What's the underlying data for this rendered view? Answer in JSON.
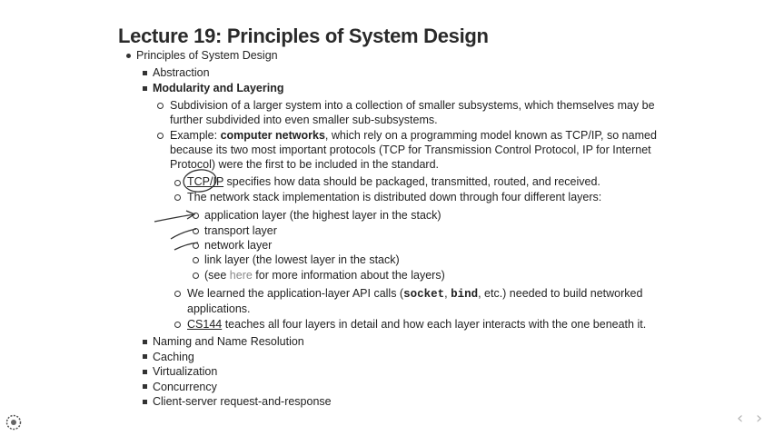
{
  "title": "Lecture 19: Principles of System Design",
  "items": {
    "principles": "Principles of System Design",
    "abstraction": "Abstraction",
    "modularity": "Modularity and Layering",
    "subdivision_1": "Subdivision of a larger system into a collection of smaller subsystems, which themselves may be",
    "subdivision_2": "further subdivided into even smaller sub-subsystems.",
    "example_prefix": "Example: ",
    "example_bold": "computer networks",
    "example_rest": ", which rely on a programming model known as TCP/IP, so named",
    "example_2": "because its two most important protocols (TCP for Transmission Control Protocol, IP for Internet",
    "example_3": "Protocol) were the first to be included in the standard.",
    "tcpip_link": "TCP/IP",
    "tcpip_rest": " specifies how data should be packaged, transmitted, routed, and received.",
    "stack": "The network stack implementation is distributed down through four different layers:",
    "layer_app": "application layer (the highest layer in the stack)",
    "layer_transport": "transport layer",
    "layer_network": "network layer",
    "layer_link": "link layer (the lowest layer in the stack)",
    "see_prefix": "(see ",
    "see_link": "here",
    "see_rest": " for more information about the layers)",
    "api_prefix": "We learned the application-layer API calls (",
    "api_socket": "socket",
    "api_sep": ", ",
    "api_bind": "bind",
    "api_rest": ", etc.) needed to build networked",
    "api_2": "applications.",
    "cs144_link": "CS144",
    "cs144_rest": " teaches all four layers in detail and how each layer interacts with the one beneath it.",
    "naming": "Naming and Name Resolution",
    "caching": "Caching",
    "virtualization": "Virtualization",
    "concurrency": "Concurrency",
    "client_server": "Client-server request-and-response"
  },
  "nav": {
    "prev": "‹",
    "next": "›"
  }
}
